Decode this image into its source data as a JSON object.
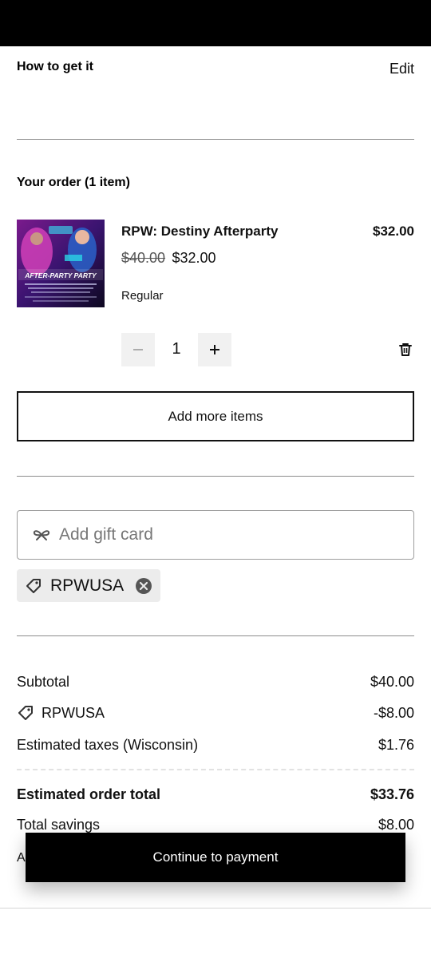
{
  "delivery": {
    "title": "How to get it",
    "edit_label": "Edit"
  },
  "order": {
    "title": "Your order (1 item)",
    "item": {
      "name": "RPW: Destiny Afterparty",
      "line_price": "$32.00",
      "original_price": "$40.00",
      "sale_price": "$32.00",
      "variant": "Regular",
      "quantity": "1",
      "thumbnail_caption": "AFTER-PARTY PARTY"
    },
    "add_more_label": "Add more items"
  },
  "gift_card": {
    "placeholder": "Add gift card"
  },
  "discount": {
    "code": "RPWUSA"
  },
  "summary": {
    "subtotal_label": "Subtotal",
    "subtotal_value": "$40.00",
    "discount_label": "RPWUSA",
    "discount_value": "-$8.00",
    "taxes_label": "Estimated taxes (Wisconsin)",
    "taxes_value": "$1.76",
    "total_label": "Estimated order total",
    "total_value": "$33.76",
    "savings_label": "Total savings",
    "savings_value": "$8.00",
    "partial_text": "A"
  },
  "cta": {
    "label": "Continue to payment"
  },
  "icons": {
    "minus": "minus-icon",
    "plus": "plus-icon",
    "trash": "trash-icon",
    "gift": "gift-icon",
    "tag": "tag-icon",
    "remove": "close-circle-icon"
  }
}
